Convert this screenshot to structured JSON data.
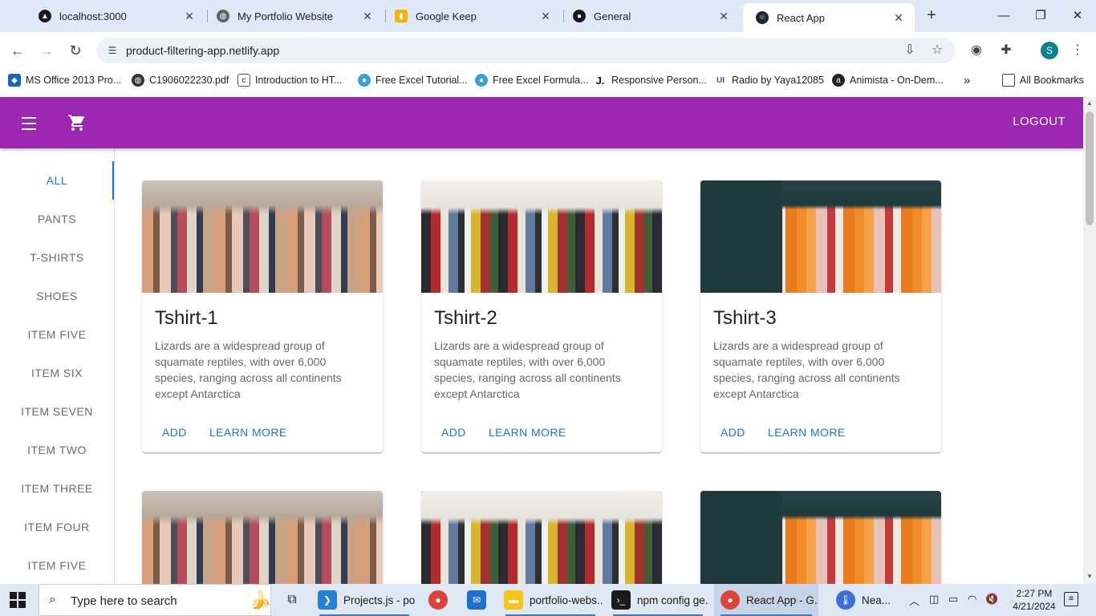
{
  "browser": {
    "tabs": [
      {
        "title": "localhost:3000",
        "icon": "localhost-icon"
      },
      {
        "title": "My Portfolio Website",
        "icon": "globe-icon"
      },
      {
        "title": "Google Keep",
        "icon": "keep-icon"
      },
      {
        "title": "General",
        "icon": "github-icon"
      },
      {
        "title": "React App",
        "icon": "react-icon",
        "active": true
      }
    ],
    "url": "product-filtering-app.netlify.app",
    "profile_initial": "S",
    "bookmarks": [
      "MS Office 2013 Pro...",
      "C1906022230.pdf",
      "Introduction to HT...",
      "Free Excel Tutorial...",
      "Free Excel Formula...",
      "Responsive Person...",
      "Radio by Yaya12085",
      "Animista - On-Dem..."
    ],
    "all_bookmarks": "All Bookmarks"
  },
  "app": {
    "accent": "#9c27b0",
    "logout": "LOGOUT",
    "categories": [
      "ALL",
      "PANTS",
      "T-SHIRTS",
      "SHOES",
      "ITEM FIVE",
      "ITEM SIX",
      "ITEM SEVEN",
      "ITEM TWO",
      "ITEM THREE",
      "ITEM FOUR",
      "ITEM FIVE"
    ],
    "active_category": "ALL",
    "products": [
      {
        "title": "Tshirt-1",
        "desc": "Lizards are a widespread group of squamate reptiles, with over 6,000 species, ranging across all continents except Antarctica",
        "add": "ADD",
        "learn": "LEARN MORE"
      },
      {
        "title": "Tshirt-2",
        "desc": "Lizards are a widespread group of squamate reptiles, with over 6,000 species, ranging across all continents except Antarctica",
        "add": "ADD",
        "learn": "LEARN MORE"
      },
      {
        "title": "Tshirt-3",
        "desc": "Lizards are a widespread group of squamate reptiles, with over 6,000 species, ranging across all continents except Antarctica",
        "add": "ADD",
        "learn": "LEARN MORE"
      }
    ]
  },
  "taskbar": {
    "search_placeholder": "Type here to search",
    "apps": [
      {
        "label": "Projects.js - po...",
        "icon": "vscode-icon"
      },
      {
        "label": "",
        "icon": "chrome-icon"
      },
      {
        "label": "",
        "icon": "mail-icon"
      },
      {
        "label": "portfolio-webs...",
        "icon": "folder-icon"
      },
      {
        "label": "npm config ge...",
        "icon": "terminal-icon"
      },
      {
        "label": "React App - G...",
        "icon": "chrome-icon",
        "active": true
      },
      {
        "label": "Nea...",
        "icon": "thermometer-icon"
      }
    ],
    "time": "2:27 PM",
    "date": "4/21/2024"
  }
}
